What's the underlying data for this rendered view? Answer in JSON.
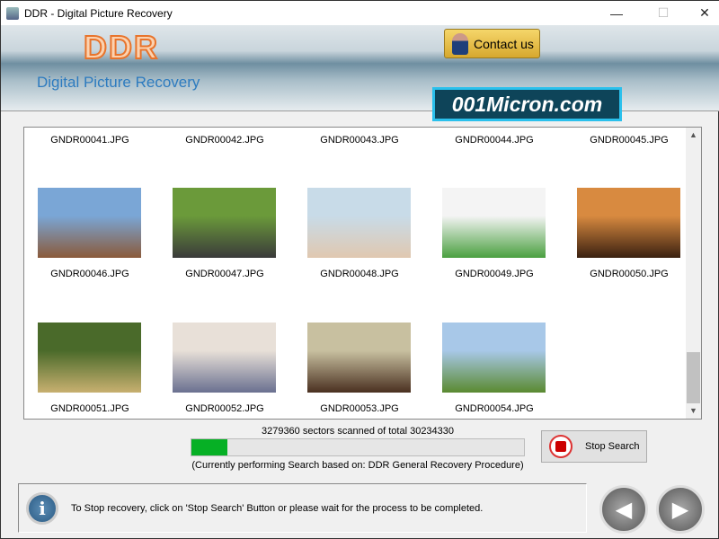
{
  "window": {
    "title": "DDR - Digital Picture Recovery",
    "minimize": "—",
    "maximize": "☐",
    "close": "✕"
  },
  "banner": {
    "logo": "DDR",
    "subtitle": "Digital Picture Recovery",
    "contact_label": "Contact us",
    "brand": "001Micron.com"
  },
  "files": [
    {
      "name": "GNDR00041.JPG",
      "thumb": false
    },
    {
      "name": "GNDR00042.JPG",
      "thumb": false
    },
    {
      "name": "GNDR00043.JPG",
      "thumb": false
    },
    {
      "name": "GNDR00044.JPG",
      "thumb": false
    },
    {
      "name": "GNDR00045.JPG",
      "thumb": false
    },
    {
      "name": "GNDR00046.JPG",
      "thumb": true,
      "colors": [
        "#7aa6d6",
        "#8a5a3a"
      ]
    },
    {
      "name": "GNDR00047.JPG",
      "thumb": true,
      "colors": [
        "#6b9a3a",
        "#3a3a3a"
      ]
    },
    {
      "name": "GNDR00048.JPG",
      "thumb": true,
      "colors": [
        "#c8dbe8",
        "#e0c8b0"
      ]
    },
    {
      "name": "GNDR00049.JPG",
      "thumb": true,
      "colors": [
        "#f4f4f4",
        "#4aa040"
      ]
    },
    {
      "name": "GNDR00050.JPG",
      "thumb": true,
      "colors": [
        "#d88a40",
        "#3a2010"
      ]
    },
    {
      "name": "GNDR00051.JPG",
      "thumb": true,
      "colors": [
        "#4a6a2a",
        "#c8b070"
      ]
    },
    {
      "name": "GNDR00052.JPG",
      "thumb": true,
      "colors": [
        "#e8e0d8",
        "#6a7090"
      ]
    },
    {
      "name": "GNDR00053.JPG",
      "thumb": true,
      "colors": [
        "#c8c0a0",
        "#4a3020"
      ]
    },
    {
      "name": "GNDR00054.JPG",
      "thumb": true,
      "colors": [
        "#a8c8e8",
        "#5a8a30"
      ]
    }
  ],
  "scan": {
    "status": "3279360 sectors scanned of total 30234330",
    "progress_percent": 10.8,
    "procedure": "(Currently performing Search based on:  DDR General Recovery Procedure)",
    "stop_label": "Stop Search"
  },
  "info": {
    "icon": "i",
    "message": "To Stop recovery, click on 'Stop Search' Button or please wait for the process to be completed."
  },
  "nav": {
    "back": "◀",
    "next": "▶"
  }
}
